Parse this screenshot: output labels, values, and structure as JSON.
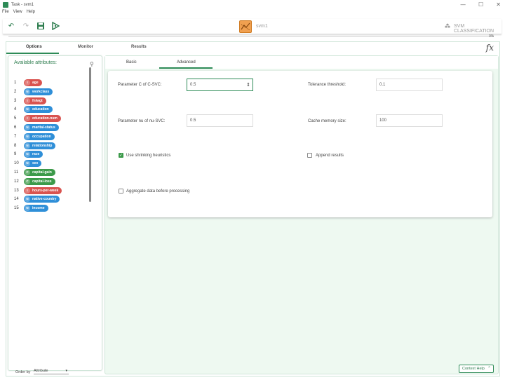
{
  "window": {
    "title": "Task - svm1",
    "minimize": "—",
    "maximize": "☐",
    "close": "✕"
  },
  "menu": [
    "File",
    "View",
    "Help"
  ],
  "toolbar": {
    "task_name": "svm1",
    "task_type": "SVM CLASSIFICATION"
  },
  "progress": {
    "label": "0%",
    "value": 0
  },
  "main_tabs": [
    "Options",
    "Monitor",
    "Results"
  ],
  "fx_label": "fx",
  "left_panel": {
    "title": "Available attributes:",
    "attributes": [
      {
        "num": "1",
        "type": "I",
        "name": "age"
      },
      {
        "num": "2",
        "type": "N",
        "name": "workclass"
      },
      {
        "num": "3",
        "type": "I",
        "name": "fnlwgt"
      },
      {
        "num": "4",
        "type": "N",
        "name": "education"
      },
      {
        "num": "5",
        "type": "I",
        "name": "education-num"
      },
      {
        "num": "6",
        "type": "N",
        "name": "marital-status"
      },
      {
        "num": "7",
        "type": "N",
        "name": "occupation"
      },
      {
        "num": "8",
        "type": "N",
        "name": "relationship"
      },
      {
        "num": "9",
        "type": "N",
        "name": "race"
      },
      {
        "num": "10",
        "type": "N",
        "name": "sex"
      },
      {
        "num": "11",
        "type": "C",
        "name": "capital-gain"
      },
      {
        "num": "12",
        "type": "C",
        "name": "capital-loss"
      },
      {
        "num": "13",
        "type": "I",
        "name": "hours-per-week"
      },
      {
        "num": "14",
        "type": "N",
        "name": "native-country"
      },
      {
        "num": "15",
        "type": "N",
        "name": "income"
      }
    ],
    "order_by_label": "Order by",
    "order_by_value": "Attribute"
  },
  "sub_tabs": [
    "Basic",
    "Advanced"
  ],
  "form": {
    "param_c_label": "Parameter C of C-SVC:",
    "param_c_value": "0.5",
    "tolerance_label": "Tolerance threshold:",
    "tolerance_value": "0.1",
    "param_nu_label": "Parameter nu of nu-SVC:",
    "param_nu_value": "0.5",
    "cache_label": "Cache memory size:",
    "cache_value": "100",
    "shrinking_label": "Use shrinking heuristics",
    "shrinking_checked": true,
    "append_label": "Append results",
    "append_checked": false,
    "aggregate_label": "Aggregate data before processing",
    "aggregate_checked": false
  },
  "context_help": "Context Help"
}
